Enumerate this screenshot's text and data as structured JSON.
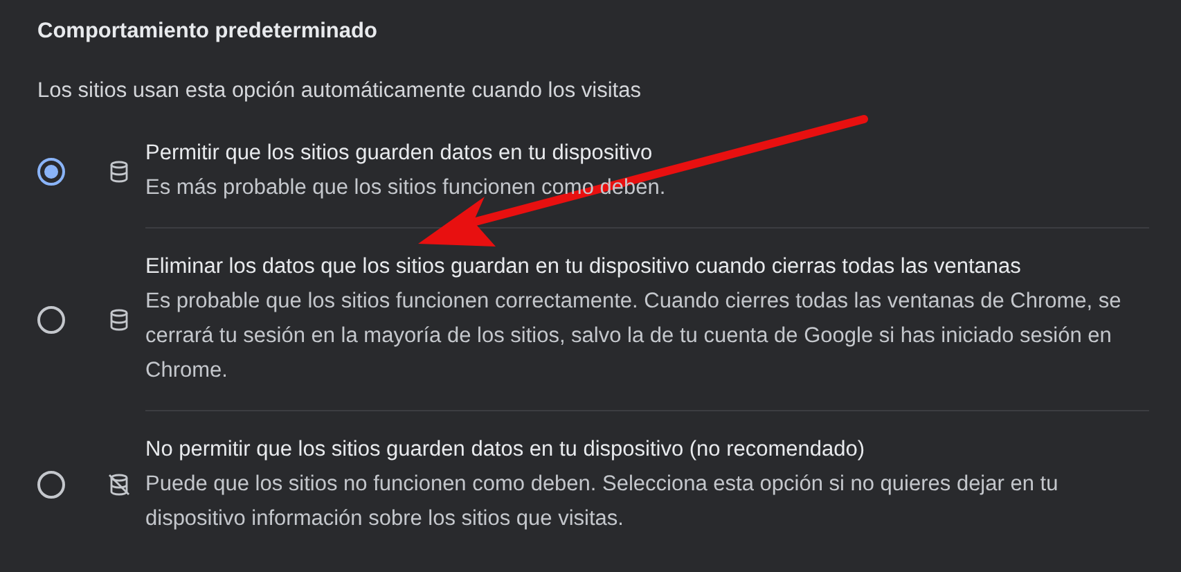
{
  "section": {
    "title": "Comportamiento predeterminado",
    "subtitle": "Los sitios usan esta opción automáticamente cuando los visitas"
  },
  "options": [
    {
      "kind": "allow",
      "selected": true,
      "label": "Permitir que los sitios guarden datos en tu dispositivo",
      "description": "Es más probable que los sitios funcionen como deben."
    },
    {
      "kind": "clear",
      "selected": false,
      "label": "Eliminar los datos que los sitios guardan en tu dispositivo cuando cierras todas las ventanas",
      "description": "Es probable que los sitios funcionen correctamente. Cuando cierres todas las ventanas de Chrome, se cerrará tu sesión en la mayoría de los sitios, salvo la de tu cuenta de Google si has iniciado sesión en Chrome."
    },
    {
      "kind": "block",
      "selected": false,
      "label": "No permitir que los sitios guarden datos en tu dispositivo (no recomendado)",
      "description": "Puede que los sitios no funcionen como deben. Selecciona esta opción si no quieres dejar en tu dispositivo información sobre los sitios que visitas."
    }
  ],
  "annotation": {
    "kind": "arrow",
    "color": "#e81010"
  }
}
